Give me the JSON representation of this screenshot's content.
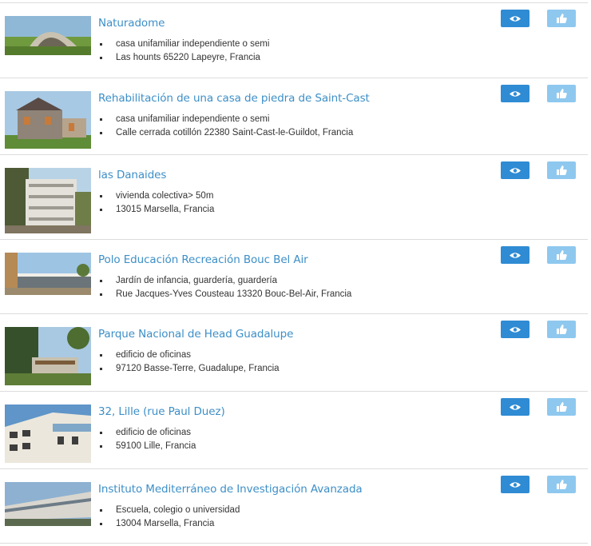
{
  "projects": [
    {
      "title": "Naturadome",
      "bullets": [
        "casa unifamiliar independiente o semi",
        "Las hounts 65220 Lapeyre, Francia"
      ],
      "image": "dome-house-photo",
      "view_icon": "eye-icon",
      "like_icon": "thumbs-up-icon"
    },
    {
      "title": "Rehabilitación de una casa de piedra de Saint-Cast",
      "bullets": [
        "casa unifamiliar independiente o semi",
        "Calle cerrada cotillón 22380 Saint-Cast-le-Guildot, Francia"
      ],
      "image": "stone-house-photo",
      "view_icon": "eye-icon",
      "like_icon": "thumbs-up-icon"
    },
    {
      "title": "las Danaides",
      "bullets": [
        "vivienda colectiva> 50m",
        "13015 Marsella, Francia"
      ],
      "image": "apartment-building-photo",
      "view_icon": "eye-icon",
      "like_icon": "thumbs-up-icon"
    },
    {
      "title": "Polo Educación Recreación Bouc Bel Air",
      "bullets": [
        "Jardín de infancia, guardería, guardería",
        "Rue Jacques-Yves Cousteau 13320 Bouc-Bel-Air, Francia"
      ],
      "image": "school-building-photo",
      "view_icon": "eye-icon",
      "like_icon": "thumbs-up-icon"
    },
    {
      "title": "Parque Nacional de Head Guadalupe",
      "bullets": [
        "edificio de oficinas",
        "97120 Basse-Terre, Guadalupe, Francia"
      ],
      "image": "park-office-photo",
      "view_icon": "eye-icon",
      "like_icon": "thumbs-up-icon"
    },
    {
      "title": "32, Lille (rue Paul Duez)",
      "bullets": [
        "edificio de oficinas",
        "59100 Lille, Francia"
      ],
      "image": "office-block-photo",
      "view_icon": "eye-icon",
      "like_icon": "thumbs-up-icon"
    },
    {
      "title": "Instituto Mediterráneo de Investigación Avanzada",
      "bullets": [
        "Escuela, colegio o universidad",
        "13004 Marsella, Francia"
      ],
      "image": "institute-building-photo",
      "view_icon": "eye-icon",
      "like_icon": "thumbs-up-icon"
    }
  ],
  "colors": {
    "title_link": "#3d8fc7",
    "view_button": "#2f8bd3",
    "like_button": "#8ec8ef",
    "divider": "#dcdcdc"
  }
}
